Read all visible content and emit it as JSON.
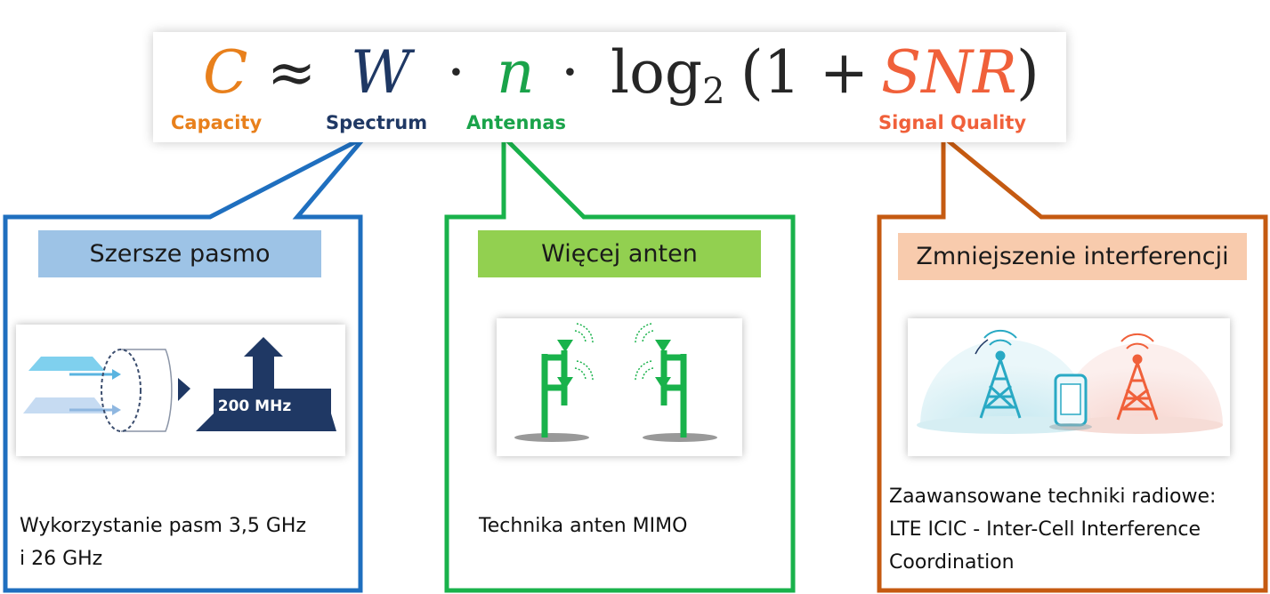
{
  "formula": {
    "capacity_symbol": "C",
    "approx_symbol": "≈",
    "spectrum_symbol": "W",
    "dot_symbol": "·",
    "antennas_symbol": "n",
    "log_text": "log",
    "log_base": "2",
    "open_paren": "(1 +",
    "snr_symbol": "SNR",
    "close_paren": ")",
    "labels": {
      "capacity": "Capacity",
      "spectrum": "Spectrum",
      "antennas": "Antennas",
      "signal_quality": "Signal Quality"
    }
  },
  "panels": [
    {
      "heading": "Szersze pasmo",
      "badge": "200 MHz",
      "description_lines": [
        "Wykorzystanie pasm 3,5 GHz",
        "i 26 GHz"
      ]
    },
    {
      "heading": "Więcej anten",
      "description_lines": [
        "Technika anten MIMO"
      ]
    },
    {
      "heading": "Zmniejszenie interferencji",
      "description_lines": [
        "Zaawansowane techniki radiowe:",
        "LTE ICIC - Inter-Cell Interference",
        "Coordination"
      ]
    }
  ],
  "colors": {
    "capacity": "#e8801c",
    "spectrum": "#1f3864",
    "antennas": "#1aa34a",
    "signal_quality": "#f0603a",
    "panel_blue": "#1f6fbf",
    "panel_green": "#19b24b",
    "panel_orange": "#c55a11",
    "heading_blue": "#9dc3e6",
    "heading_green": "#92d050",
    "heading_orange": "#f8cbad"
  }
}
